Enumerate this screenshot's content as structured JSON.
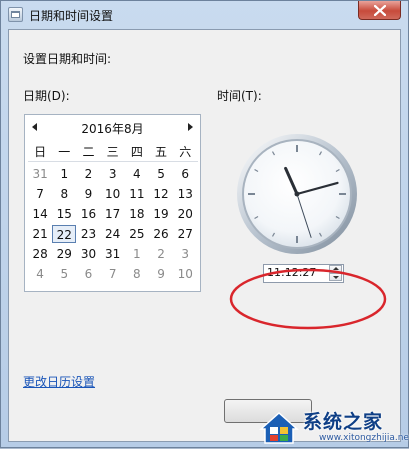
{
  "window": {
    "title": "日期和时间设置",
    "close_icon": "close-icon"
  },
  "main": {
    "heading": "设置日期和时间:",
    "date_label": "日期(D):",
    "time_label": "时间(T):",
    "change_calendar_link": "更改日历设置"
  },
  "calendar": {
    "month_title": "2016年8月",
    "weekdays": [
      "日",
      "一",
      "二",
      "三",
      "四",
      "五",
      "六"
    ],
    "weeks": [
      [
        "31",
        "1",
        "2",
        "3",
        "4",
        "5",
        "6"
      ],
      [
        "7",
        "8",
        "9",
        "10",
        "11",
        "12",
        "13"
      ],
      [
        "14",
        "15",
        "16",
        "17",
        "18",
        "19",
        "20"
      ],
      [
        "21",
        "22",
        "23",
        "24",
        "25",
        "26",
        "27"
      ],
      [
        "28",
        "29",
        "30",
        "31",
        "1",
        "2",
        "3"
      ],
      [
        "4",
        "5",
        "6",
        "7",
        "8",
        "9",
        "10"
      ]
    ],
    "selected_day": "22"
  },
  "time": {
    "value": "11:12:27"
  },
  "watermark": {
    "brand": "系统之家",
    "url": "www.xitongzhijia.net"
  },
  "colors": {
    "highlight_ellipse": "#d9262c",
    "link": "#1a55b8"
  }
}
